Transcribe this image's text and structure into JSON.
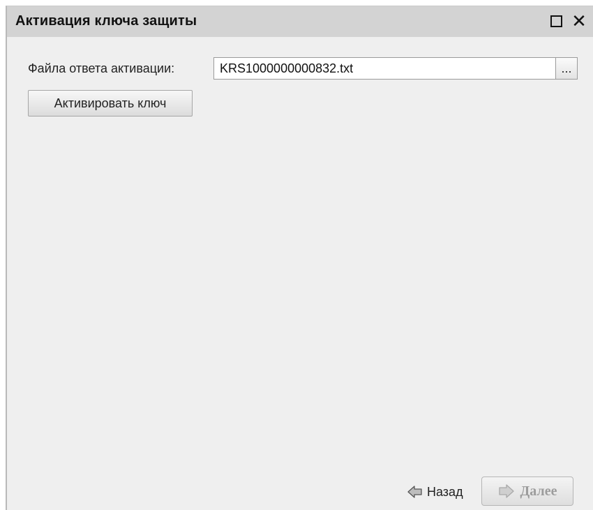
{
  "window": {
    "title": "Активация ключа защиты",
    "maximize_icon": "maximize-icon",
    "close_icon": "close-icon",
    "close_glyph": "✕"
  },
  "form": {
    "file_label": "Файла ответа активации:",
    "file_value": "KRS1000000000832.txt",
    "browse_label": "...",
    "activate_button": "Активировать ключ"
  },
  "footer": {
    "back_icon": "arrow-left-icon",
    "back_label": "Назад",
    "next_icon": "arrow-right-icon",
    "next_label": "Далее",
    "next_enabled": false
  },
  "colors": {
    "titlebar": "#d3d3d3",
    "window_bg": "#efefef",
    "disabled_text": "#9c9c9c"
  }
}
